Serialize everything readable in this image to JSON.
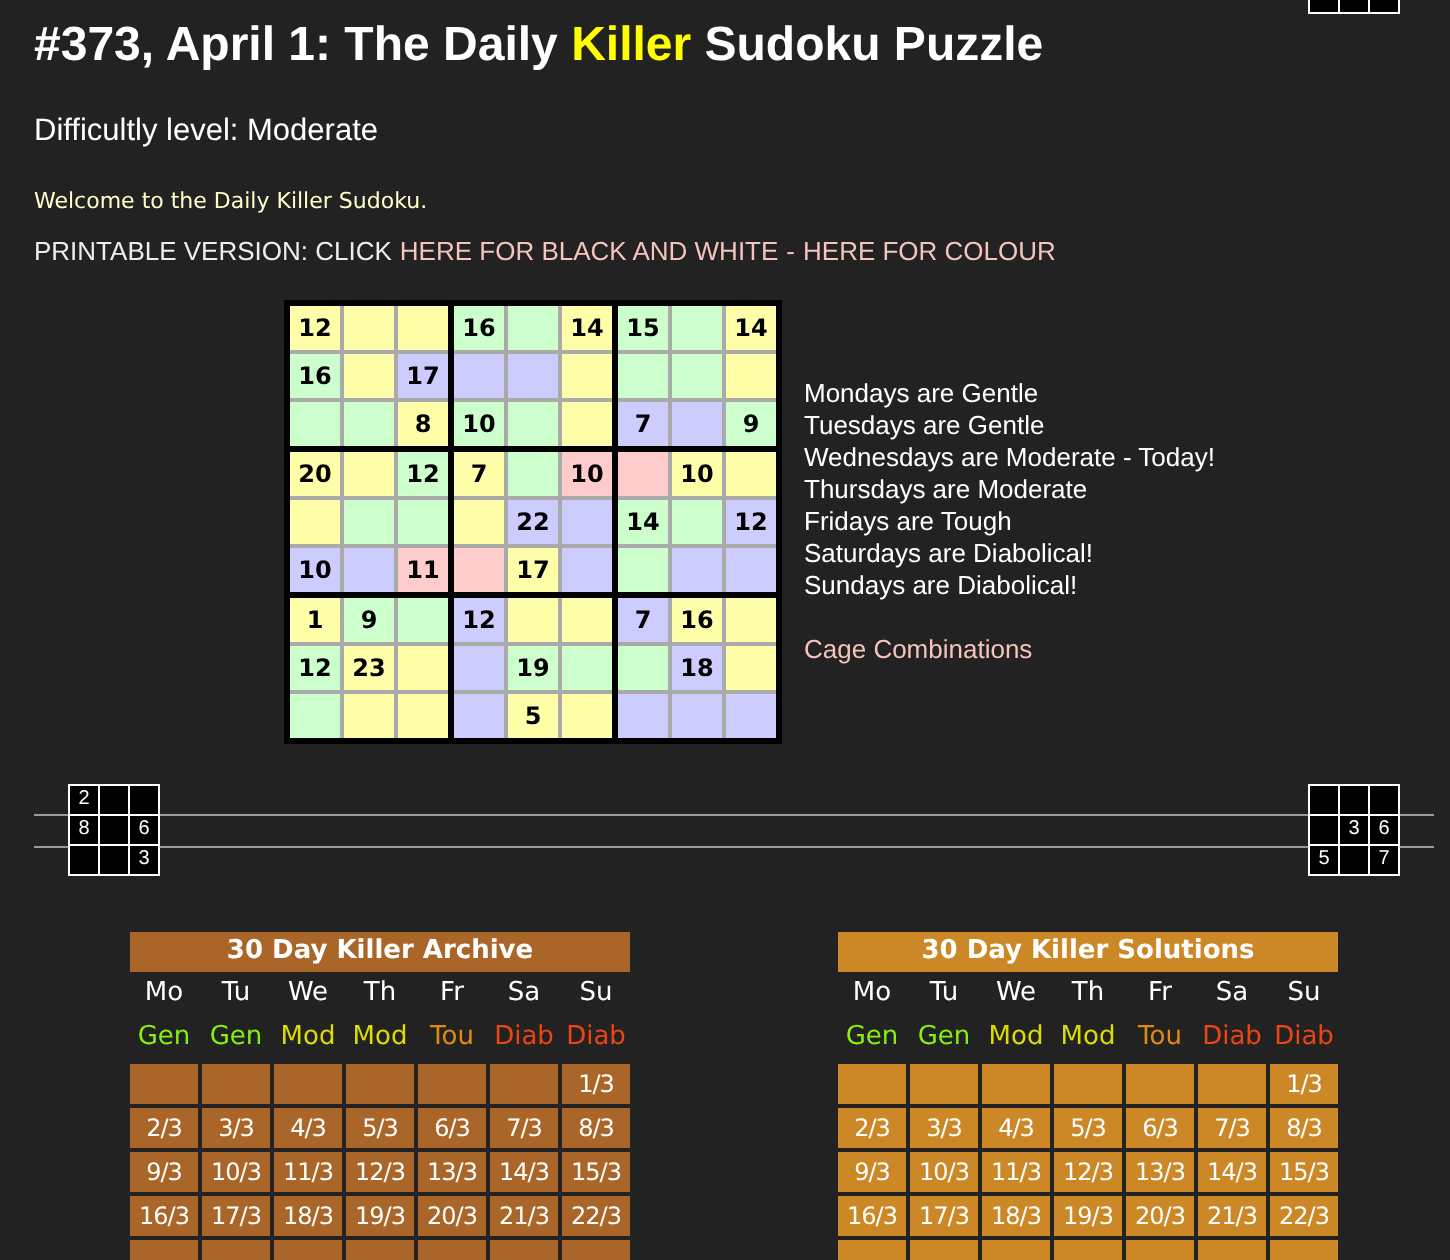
{
  "title_parts": [
    {
      "text": "#373, April 1: The Daily",
      "highlight": false
    },
    {
      "text": "Killer",
      "highlight": true
    },
    {
      "text": "Sudoku Puzzle",
      "highlight": false
    }
  ],
  "difficulty": "Difficultly level: Moderate",
  "welcome": "Welcome to the Daily Killer Sudoku.",
  "printable": {
    "label": "PRINTABLE VERSION: CLICK",
    "links": [
      "HERE FOR BLACK AND WHITE",
      "HERE FOR COLOUR"
    ],
    "separator": "-"
  },
  "puzzle": {
    "rows": [
      [
        {
          "color": "#ffffaa",
          "clue": "12"
        },
        {
          "color": "#ffffaa"
        },
        {
          "color": "#ffffaa"
        },
        {
          "color": "#ccffcc",
          "clue": "16"
        },
        {
          "color": "#ccffcc"
        },
        {
          "color": "#ffffaa",
          "clue": "14"
        },
        {
          "color": "#ccffcc",
          "clue": "15"
        },
        {
          "color": "#ccffcc"
        },
        {
          "color": "#ffffaa",
          "clue": "14"
        }
      ],
      [
        {
          "color": "#ccffcc",
          "clue": "16"
        },
        {
          "color": "#ffffaa"
        },
        {
          "color": "#ccccff",
          "clue": "17"
        },
        {
          "color": "#ccccff"
        },
        {
          "color": "#ccccff"
        },
        {
          "color": "#ffffaa"
        },
        {
          "color": "#ccffcc"
        },
        {
          "color": "#ccffcc"
        },
        {
          "color": "#ffffaa"
        }
      ],
      [
        {
          "color": "#ccffcc"
        },
        {
          "color": "#ccffcc"
        },
        {
          "color": "#ffffaa",
          "clue": "8"
        },
        {
          "color": "#ccffcc",
          "clue": "10"
        },
        {
          "color": "#ccffcc"
        },
        {
          "color": "#ffffaa"
        },
        {
          "color": "#ccccff",
          "clue": "7"
        },
        {
          "color": "#ccccff"
        },
        {
          "color": "#ccffcc",
          "clue": "9"
        }
      ],
      [
        {
          "color": "#ffffaa",
          "clue": "20"
        },
        {
          "color": "#ffffaa"
        },
        {
          "color": "#ccffcc",
          "clue": "12"
        },
        {
          "color": "#ffffaa",
          "clue": "7"
        },
        {
          "color": "#ccffcc"
        },
        {
          "color": "#ffcccc",
          "clue": "10"
        },
        {
          "color": "#ffcccc"
        },
        {
          "color": "#ffffaa",
          "clue": "10"
        },
        {
          "color": "#ffffaa"
        }
      ],
      [
        {
          "color": "#ffffaa"
        },
        {
          "color": "#ccffcc"
        },
        {
          "color": "#ccffcc"
        },
        {
          "color": "#ffffaa"
        },
        {
          "color": "#ccccff",
          "clue": "22"
        },
        {
          "color": "#ccccff"
        },
        {
          "color": "#ccffcc",
          "clue": "14"
        },
        {
          "color": "#ccffcc"
        },
        {
          "color": "#ccccff",
          "clue": "12"
        }
      ],
      [
        {
          "color": "#ccccff",
          "clue": "10"
        },
        {
          "color": "#ccccff"
        },
        {
          "color": "#ffcccc",
          "clue": "11"
        },
        {
          "color": "#ffcccc"
        },
        {
          "color": "#ffffaa",
          "clue": "17"
        },
        {
          "color": "#ccccff"
        },
        {
          "color": "#ccffcc"
        },
        {
          "color": "#ccccff"
        },
        {
          "color": "#ccccff"
        }
      ],
      [
        {
          "color": "#ffffaa",
          "clue": "1"
        },
        {
          "color": "#ccffcc",
          "clue": "9"
        },
        {
          "color": "#ccffcc"
        },
        {
          "color": "#ccccff",
          "clue": "12"
        },
        {
          "color": "#ffffaa"
        },
        {
          "color": "#ffffaa"
        },
        {
          "color": "#ccccff",
          "clue": "7"
        },
        {
          "color": "#ffffaa",
          "clue": "16"
        },
        {
          "color": "#ffffaa"
        }
      ],
      [
        {
          "color": "#ccffcc",
          "clue": "12"
        },
        {
          "color": "#ffffaa",
          "clue": "23"
        },
        {
          "color": "#ffffaa"
        },
        {
          "color": "#ccccff"
        },
        {
          "color": "#ccffcc",
          "clue": "19"
        },
        {
          "color": "#ccffcc"
        },
        {
          "color": "#ccffcc"
        },
        {
          "color": "#ccccff",
          "clue": "18"
        },
        {
          "color": "#ffffaa"
        }
      ],
      [
        {
          "color": "#ccffcc"
        },
        {
          "color": "#ffffaa"
        },
        {
          "color": "#ffffaa"
        },
        {
          "color": "#ccccff"
        },
        {
          "color": "#ffffaa",
          "clue": "5"
        },
        {
          "color": "#ffffaa"
        },
        {
          "color": "#ccccff"
        },
        {
          "color": "#ccccff"
        },
        {
          "color": "#ccccff"
        }
      ]
    ]
  },
  "schedule": [
    "Mondays are Gentle",
    "Tuesdays are Gentle",
    "Wednesdays are Moderate - Today!",
    "Thursdays are Moderate",
    "Fridays are Tough",
    "Saturdays are Diabolical!",
    "Sundays are Diabolical!"
  ],
  "cage_link": "Cage Combinations",
  "divider": {
    "left_grid": [
      {
        "kind": "digit",
        "digit": "2"
      },
      {
        "kind": "blank"
      },
      {
        "kind": "blank"
      },
      {
        "kind": "digit",
        "digit": "8"
      },
      {
        "kind": "blank"
      },
      {
        "kind": "digit",
        "digit": "6"
      },
      {
        "kind": "blank"
      },
      {
        "kind": "blank"
      },
      {
        "kind": "digit",
        "digit": "3"
      }
    ],
    "right_grid": [
      {
        "kind": "blank"
      },
      {
        "kind": "blank"
      },
      {
        "kind": "blank"
      },
      {
        "kind": "blank"
      },
      {
        "kind": "digit",
        "digit": "3"
      },
      {
        "kind": "digit",
        "digit": "6"
      },
      {
        "kind": "digit",
        "digit": "5"
      },
      {
        "kind": "blank"
      },
      {
        "kind": "digit",
        "digit": "7"
      }
    ]
  },
  "calendars": [
    {
      "title": "30 Day Killer Archive",
      "color": "#aa6628",
      "days": [
        "Mo",
        "Tu",
        "We",
        "Th",
        "Fr",
        "Sa",
        "Su"
      ],
      "levels": [
        {
          "label": "Gen",
          "color": "#88ee11"
        },
        {
          "label": "Gen",
          "color": "#88ee11"
        },
        {
          "label": "Mod",
          "color": "#dddd00"
        },
        {
          "label": "Mod",
          "color": "#dddd00"
        },
        {
          "label": "Tou",
          "color": "#e08a10"
        },
        {
          "label": "Diab",
          "color": "#ee4411"
        },
        {
          "label": "Diab",
          "color": "#ee4411"
        }
      ],
      "weeks": [
        [
          {
            "kind": "blank"
          },
          {
            "kind": "blank"
          },
          {
            "kind": "blank"
          },
          {
            "kind": "blank"
          },
          {
            "kind": "blank"
          },
          {
            "kind": "blank"
          },
          {
            "kind": "date",
            "date": "1/3"
          }
        ],
        [
          {
            "kind": "date",
            "date": "2/3"
          },
          {
            "kind": "date",
            "date": "3/3"
          },
          {
            "kind": "date",
            "date": "4/3"
          },
          {
            "kind": "date",
            "date": "5/3"
          },
          {
            "kind": "date",
            "date": "6/3"
          },
          {
            "kind": "date",
            "date": "7/3"
          },
          {
            "kind": "date",
            "date": "8/3"
          }
        ],
        [
          {
            "kind": "date",
            "date": "9/3"
          },
          {
            "kind": "date",
            "date": "10/3"
          },
          {
            "kind": "date",
            "date": "11/3"
          },
          {
            "kind": "date",
            "date": "12/3"
          },
          {
            "kind": "date",
            "date": "13/3"
          },
          {
            "kind": "date",
            "date": "14/3"
          },
          {
            "kind": "date",
            "date": "15/3"
          }
        ],
        [
          {
            "kind": "date",
            "date": "16/3"
          },
          {
            "kind": "date",
            "date": "17/3"
          },
          {
            "kind": "date",
            "date": "18/3"
          },
          {
            "kind": "date",
            "date": "19/3"
          },
          {
            "kind": "date",
            "date": "20/3"
          },
          {
            "kind": "date",
            "date": "21/3"
          },
          {
            "kind": "date",
            "date": "22/3"
          }
        ],
        [
          {
            "kind": "blank"
          },
          {
            "kind": "blank"
          },
          {
            "kind": "blank"
          },
          {
            "kind": "blank"
          },
          {
            "kind": "blank"
          },
          {
            "kind": "blank"
          },
          {
            "kind": "blank"
          }
        ]
      ]
    },
    {
      "title": "30 Day Killer Solutions",
      "color": "#cc8826",
      "days": [
        "Mo",
        "Tu",
        "We",
        "Th",
        "Fr",
        "Sa",
        "Su"
      ],
      "levels": [
        {
          "label": "Gen",
          "color": "#88ee11"
        },
        {
          "label": "Gen",
          "color": "#88ee11"
        },
        {
          "label": "Mod",
          "color": "#dddd00"
        },
        {
          "label": "Mod",
          "color": "#dddd00"
        },
        {
          "label": "Tou",
          "color": "#e08a10"
        },
        {
          "label": "Diab",
          "color": "#ee4411"
        },
        {
          "label": "Diab",
          "color": "#ee4411"
        }
      ],
      "weeks": [
        [
          {
            "kind": "blank"
          },
          {
            "kind": "blank"
          },
          {
            "kind": "blank"
          },
          {
            "kind": "blank"
          },
          {
            "kind": "blank"
          },
          {
            "kind": "blank"
          },
          {
            "kind": "date",
            "date": "1/3"
          }
        ],
        [
          {
            "kind": "date",
            "date": "2/3"
          },
          {
            "kind": "date",
            "date": "3/3"
          },
          {
            "kind": "date",
            "date": "4/3"
          },
          {
            "kind": "date",
            "date": "5/3"
          },
          {
            "kind": "date",
            "date": "6/3"
          },
          {
            "kind": "date",
            "date": "7/3"
          },
          {
            "kind": "date",
            "date": "8/3"
          }
        ],
        [
          {
            "kind": "date",
            "date": "9/3"
          },
          {
            "kind": "date",
            "date": "10/3"
          },
          {
            "kind": "date",
            "date": "11/3"
          },
          {
            "kind": "date",
            "date": "12/3"
          },
          {
            "kind": "date",
            "date": "13/3"
          },
          {
            "kind": "date",
            "date": "14/3"
          },
          {
            "kind": "date",
            "date": "15/3"
          }
        ],
        [
          {
            "kind": "date",
            "date": "16/3"
          },
          {
            "kind": "date",
            "date": "17/3"
          },
          {
            "kind": "date",
            "date": "18/3"
          },
          {
            "kind": "date",
            "date": "19/3"
          },
          {
            "kind": "date",
            "date": "20/3"
          },
          {
            "kind": "date",
            "date": "21/3"
          },
          {
            "kind": "date",
            "date": "22/3"
          }
        ],
        [
          {
            "kind": "blank"
          },
          {
            "kind": "blank"
          },
          {
            "kind": "blank"
          },
          {
            "kind": "blank"
          },
          {
            "kind": "blank"
          },
          {
            "kind": "blank"
          },
          {
            "kind": "blank"
          }
        ]
      ]
    }
  ]
}
